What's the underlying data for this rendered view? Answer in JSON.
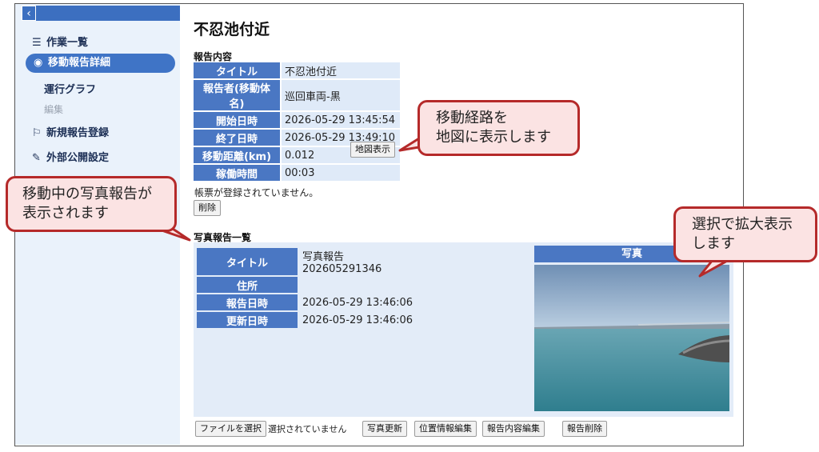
{
  "sidebar": {
    "back_icon": "‹",
    "items": [
      {
        "label": "作業一覧",
        "icon": "list-icon",
        "glyph": "☰"
      },
      {
        "label": "移動報告詳細",
        "icon": "globe-icon",
        "glyph": "◉"
      },
      {
        "label": "運行グラフ"
      },
      {
        "label": "編集"
      },
      {
        "label": "新規報告登録",
        "icon": "flag-icon",
        "glyph": "⚐"
      },
      {
        "label": "外部公開設定",
        "icon": "wrench-icon",
        "glyph": "✎"
      }
    ]
  },
  "page_title": "不忍池付近",
  "report": {
    "section_title": "報告内容",
    "rows": [
      {
        "label": "タイトル",
        "value": "不忍池付近"
      },
      {
        "label": "報告者(移動体名)",
        "value": "巡回車両-黒"
      },
      {
        "label": "開始日時",
        "value": "2026-05-29 13:45:54"
      },
      {
        "label": "終了日時",
        "value": "2026-05-29 13:49:10"
      },
      {
        "label": "移動距離(km)",
        "value": "0.012"
      },
      {
        "label": "稼働時間",
        "value": "00:03"
      }
    ],
    "map_button": "地図表示",
    "no_form_text": "帳票が登録されていません。",
    "delete_button": "削除"
  },
  "photo_reports": {
    "section_title": "写真報告一覧",
    "rows": [
      {
        "label": "タイトル",
        "value": "写真報告202605291346"
      },
      {
        "label": "住所",
        "value": ""
      },
      {
        "label": "報告日時",
        "value": "2026-05-29 13:46:06"
      },
      {
        "label": "更新日時",
        "value": "2026-05-29 13:46:06"
      }
    ],
    "photo_header": "写真",
    "choose_file_button": "ファイルを選択",
    "no_file_text": "選択されていません",
    "buttons": {
      "update_photo": "写真更新",
      "edit_location": "位置情報編集",
      "edit_content": "報告内容編集",
      "delete_report": "報告削除"
    }
  },
  "callouts": {
    "map": {
      "line1": "移動経路を",
      "line2": "地図に表示します"
    },
    "photo_list": {
      "line1": "移動中の写真報告が",
      "line2": "表示されます"
    },
    "zoom": {
      "line1": "選択で拡大表示",
      "line2": "します"
    }
  },
  "colors": {
    "accent": "#4a77c3",
    "sidebar_bg": "#eaf2fb",
    "callout_border": "#b52a2a",
    "callout_bg": "#fbe3e3"
  }
}
